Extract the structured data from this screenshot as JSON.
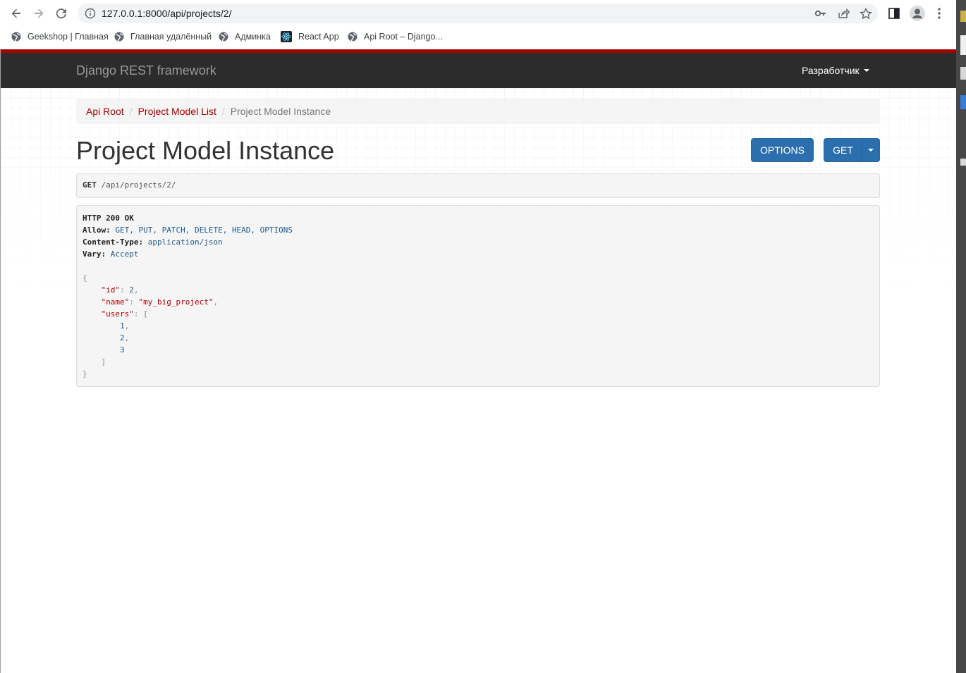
{
  "browser": {
    "url": "127.0.0.1:8000/api/projects/2/",
    "bookmarks": [
      {
        "label": "Geekshop | Главная",
        "icon": "globe-icon"
      },
      {
        "label": "Главная удалённый",
        "icon": "globe-icon"
      },
      {
        "label": "Админка",
        "icon": "globe-icon"
      },
      {
        "label": "React App",
        "icon": "react-icon"
      },
      {
        "label": "Api Root – Django...",
        "icon": "globe-icon"
      }
    ]
  },
  "navbar": {
    "brand": "Django REST framework",
    "user_menu": "Разработчик"
  },
  "breadcrumb": [
    {
      "label": "Api Root",
      "link": true
    },
    {
      "label": "Project Model List",
      "link": true
    },
    {
      "label": "Project Model Instance",
      "link": false
    }
  ],
  "page": {
    "title": "Project Model Instance",
    "options_button": "OPTIONS",
    "get_button": "GET"
  },
  "request": {
    "method": "GET",
    "path": "/api/projects/2/"
  },
  "response": {
    "status": "HTTP 200 OK",
    "headers": [
      {
        "name": "Allow:",
        "value": "GET, PUT, PATCH, DELETE, HEAD, OPTIONS"
      },
      {
        "name": "Content-Type:",
        "value": "application/json"
      },
      {
        "name": "Vary:",
        "value": "Accept"
      }
    ],
    "body": {
      "id_key": "\"id\"",
      "id_val": "2",
      "name_key": "\"name\"",
      "name_val": "\"my_big_project\"",
      "users_key": "\"users\"",
      "users": [
        "1",
        "2",
        "3"
      ]
    }
  },
  "colors": {
    "accent_red": "#a30000",
    "navbar_bg": "#2c2c2c",
    "button_blue": "#2c6faf"
  }
}
